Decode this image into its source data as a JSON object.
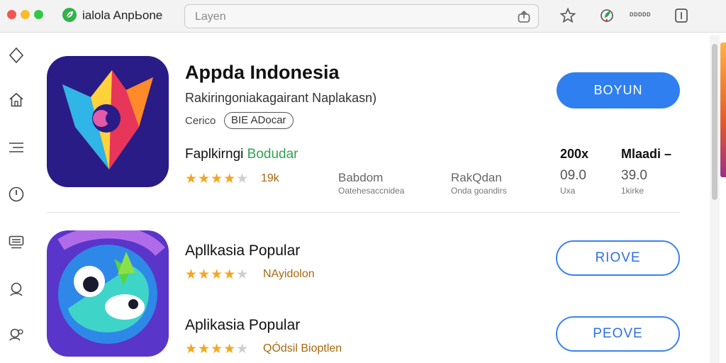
{
  "window": {
    "title": "ialola AnpЬone",
    "search_placeholder": "Layen",
    "toolbar_label": "ᴅᴅᴅᴅᴅ"
  },
  "icons": {
    "toolbar": [
      "share-icon",
      "star-icon",
      "leaf-icon",
      "tablet-icon"
    ],
    "sidebar": [
      "diamond-icon",
      "home-icon",
      "menu-icon",
      "clock-icon",
      "list-icon",
      "person-icon",
      "people-icon"
    ]
  },
  "featured": {
    "title": "Appda Indonesia",
    "subtitle": "Rakiringoniakagairant Naplakasn)",
    "category": "Cerico",
    "badge": "BIE ADocar",
    "developer_prefix": "Faplkirngi",
    "developer_link": "Bodudar",
    "rating_stars": 4.5,
    "rating_text": "19k",
    "stats": [
      {
        "head": "Babdom",
        "sub": "Oatehesaccnidea"
      },
      {
        "head": "RakQdan",
        "sub": "Onda goandirs"
      }
    ],
    "metrics": [
      {
        "head": "200x",
        "value": "09.0",
        "sub": "Uxa"
      },
      {
        "head": "Mlaadi –",
        "value": "39.0",
        "sub": "1kirke"
      }
    ],
    "button_label": "BOYUN"
  },
  "list": [
    {
      "title": "Apllkasia Popular",
      "rating_stars": 4.5,
      "rating_text": "NAyidolon",
      "button_label": "RIOVE"
    },
    {
      "title": "Aplikasia Popular",
      "rating_stars": 4.5,
      "rating_text": "QÓdsil Bioptlen",
      "button_label": "PEOVE"
    }
  ],
  "colors": {
    "accent_blue": "#2f7ff0",
    "star": "#f4a623",
    "developer_green": "#2ea44f",
    "featured_icon_bg": "#2a1c86",
    "list_icon_bg": "#5a35c9"
  }
}
